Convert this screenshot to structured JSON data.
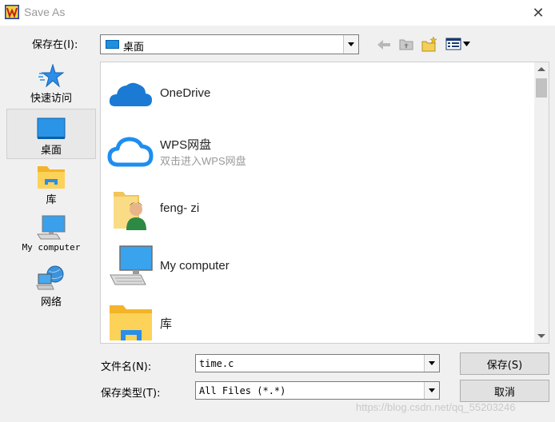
{
  "window": {
    "title": "Save As",
    "app_icon": "wps-logo-icon"
  },
  "location_bar": {
    "label": "保存在(I):",
    "current": "桌面",
    "toolbar_icons": [
      "back-arrow-icon",
      "up-folder-icon",
      "new-folder-icon",
      "view-menu-icon"
    ]
  },
  "places": [
    {
      "label": "快速访问",
      "icon": "star-icon"
    },
    {
      "label": "桌面",
      "icon": "desktop-icon",
      "selected": true
    },
    {
      "label": "库",
      "icon": "library-icon"
    },
    {
      "label": "My computer",
      "icon": "computer-icon"
    },
    {
      "label": "网络",
      "icon": "network-icon"
    }
  ],
  "files": [
    {
      "name": "OneDrive",
      "icon": "onedrive-cloud-icon"
    },
    {
      "name": "WPS网盘",
      "subtitle": "双击进入WPS网盘",
      "icon": "wps-cloud-icon"
    },
    {
      "name": "feng- zi",
      "icon": "user-folder-icon"
    },
    {
      "name": "My computer",
      "icon": "computer-icon"
    },
    {
      "name": "库",
      "icon": "library-icon"
    }
  ],
  "filename": {
    "label": "文件名(N):",
    "value": "time.c"
  },
  "filetype": {
    "label": "保存类型(T):",
    "value": "All Files (*.*)"
  },
  "buttons": {
    "save": "保存(S)",
    "cancel": "取消"
  },
  "watermark": "https://blog.csdn.net/qq_55203246"
}
